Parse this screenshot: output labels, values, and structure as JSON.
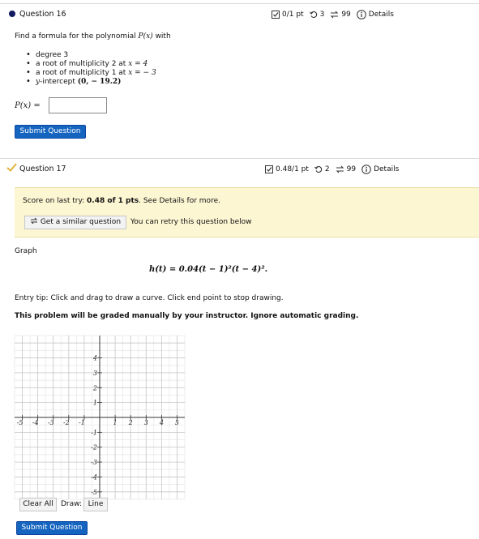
{
  "q16": {
    "title": "Question 16",
    "score": "0/1 pt",
    "retries": "3",
    "attempts": "99",
    "details": "Details",
    "prompt_prefix": "Find a formula for the polynomial",
    "prompt_math": "P(x)",
    "prompt_suffix": "with",
    "bullets": [
      {
        "text": "degree 3",
        "math": ""
      },
      {
        "text": "a root of multiplicity 2 at",
        "math": "x = 4"
      },
      {
        "text": "a root of multiplicity 1 at",
        "math": "x = − 3"
      },
      {
        "text": "",
        "math": "y",
        "after": "-intercept",
        "math2": "(0,  − 19.2)"
      }
    ],
    "answer_label": "P(x) =",
    "answer_value": "",
    "submit_label": "Submit Question"
  },
  "q17": {
    "title": "Question 17",
    "score": "0.48/1 pt",
    "retries": "2",
    "attempts": "99",
    "details": "Details",
    "last_try_prefix": "Score on last try:",
    "last_try_score": "0.48 of 1 pts",
    "last_try_suffix": ". See Details for more.",
    "similar_label": "Get a similar question",
    "retry_text": "You can retry this question below",
    "graph_label": "Graph",
    "formula": "h(t) = 0.04(t − 1)²(t − 4)².",
    "tip": "Entry tip: Click and drag to draw a curve. Click end point to stop drawing.",
    "manual": "This problem will be graded manually by your instructor. Ignore automatic grading.",
    "clear_label": "Clear All",
    "draw_label": "Draw:",
    "line_label": "Line",
    "submit_label": "Submit Question",
    "graph": {
      "x_ticks": [
        "-5",
        "-4",
        "-3",
        "-2",
        "-1",
        "1",
        "2",
        "3",
        "4",
        "5"
      ],
      "y_ticks": [
        "4",
        "3",
        "2",
        "1",
        "-1",
        "-2",
        "-3",
        "-4",
        "-5"
      ],
      "xlim": [
        -5.5,
        5.5
      ],
      "ylim": [
        -5.5,
        5.5
      ]
    }
  },
  "colors": {
    "primary": "#1565c0",
    "notice": "#fdf6d3",
    "current_dot": "#111a5e",
    "check": "#e0b33a"
  }
}
